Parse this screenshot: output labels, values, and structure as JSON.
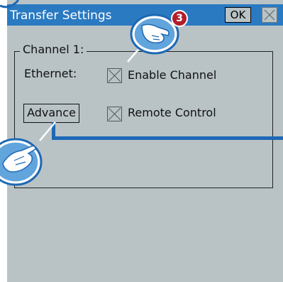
{
  "window": {
    "title": "Transfer Settings",
    "ok_label": "OK"
  },
  "group": {
    "label": "Channel 1:"
  },
  "ethernet": {
    "label": "Ethernet:",
    "checkbox_label": "Enable Channel",
    "checked": false
  },
  "advance_button": {
    "label": "Advance"
  },
  "remote": {
    "checkbox_label": "Remote Control",
    "checked": false
  },
  "callout": {
    "step_number": "3"
  },
  "colors": {
    "title_bar": "#2a7ac2",
    "background": "#b9c3c6",
    "callout_line": "#1d68b4",
    "badge": "#b21e2a"
  },
  "icons": [
    "close-icon",
    "touch-hand-icon",
    "touch-hand-icon",
    "cross-icon"
  ]
}
